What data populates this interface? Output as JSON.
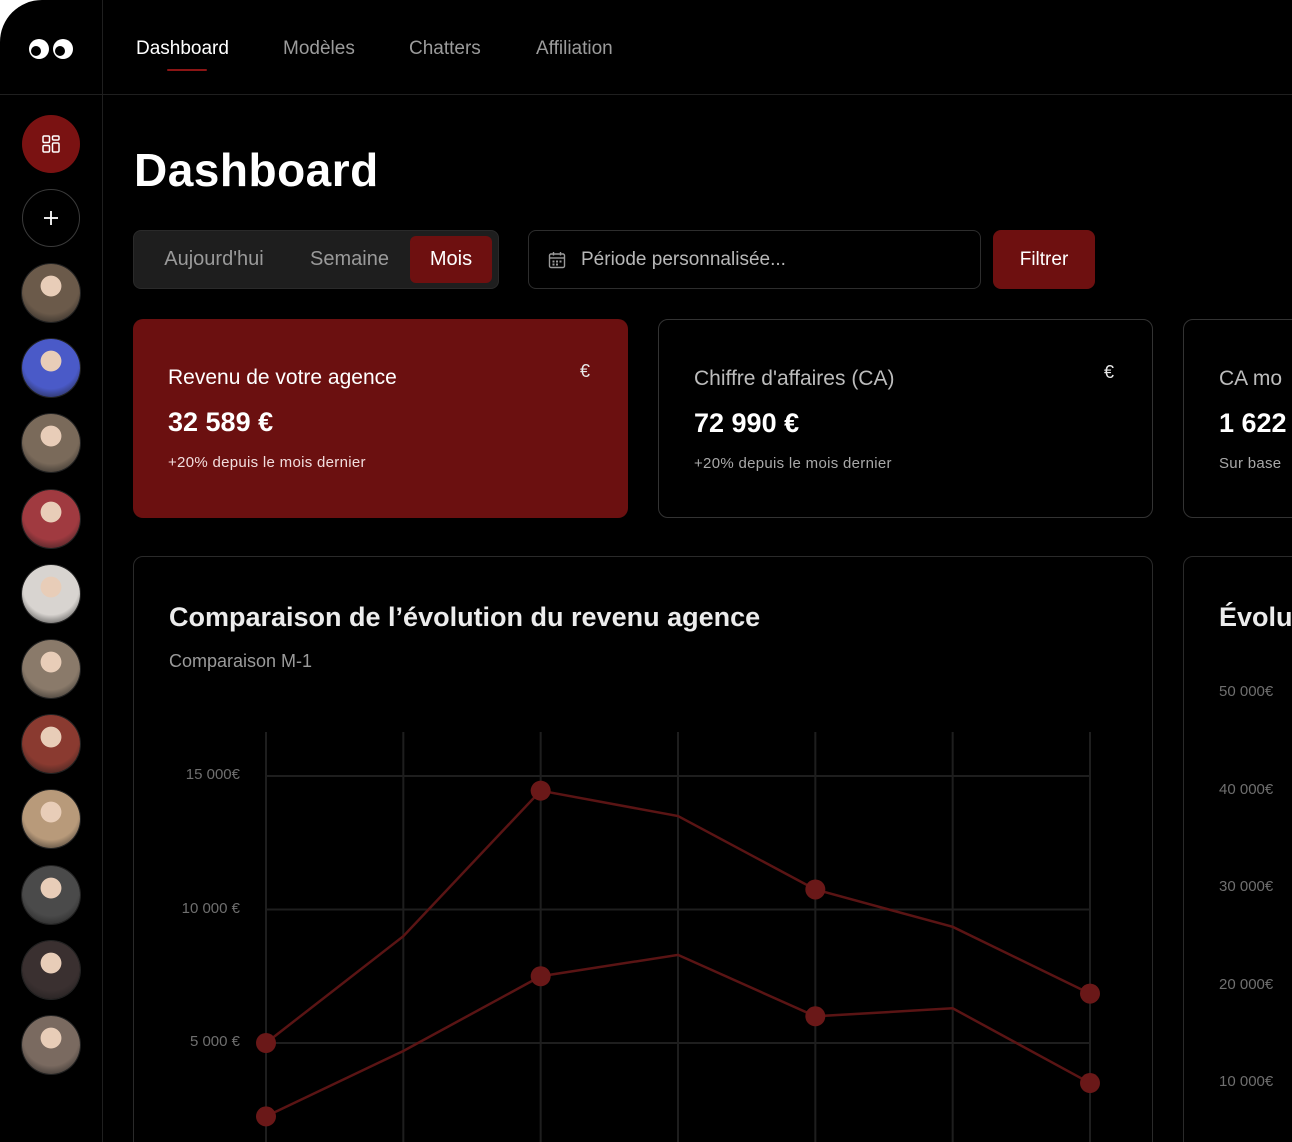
{
  "logo": {
    "icon": "eyes-logo-icon"
  },
  "sidebar": {
    "dashboard_icon": "grid-icon",
    "add_icon": "plus-icon",
    "avatars": [
      {
        "color": "#6b5a4a"
      },
      {
        "color": "#4a5ac8"
      },
      {
        "color": "#7a6a5a"
      },
      {
        "color": "#a03a40"
      },
      {
        "color": "#d8d4d0"
      },
      {
        "color": "#8a7a6a"
      },
      {
        "color": "#8a3a30"
      },
      {
        "color": "#b89a7a"
      },
      {
        "color": "#4a4a4a"
      },
      {
        "color": "#3a3030"
      },
      {
        "color": "#7a6a60"
      }
    ]
  },
  "nav": {
    "items": [
      "Dashboard",
      "Modèles",
      "Chatters",
      "Affiliation"
    ],
    "active": "Dashboard"
  },
  "page": {
    "title": "Dashboard"
  },
  "period": {
    "options": [
      "Aujourd'hui",
      "Semaine",
      "Mois"
    ],
    "selected": "Mois"
  },
  "date_input": {
    "placeholder": "Période personnalisée...",
    "icon": "calendar-icon"
  },
  "filter_button": "Filtrer",
  "cards": [
    {
      "title": "Revenu de votre agence",
      "value": "32 589 €",
      "sub": "+20% depuis le mois dernier",
      "icon": "€"
    },
    {
      "title": "Chiffre d'affaires (CA)",
      "value": "72 990 €",
      "sub": "+20% depuis le mois dernier",
      "icon": "€"
    },
    {
      "title": "CA mo",
      "value": "1 622",
      "sub": "Sur base"
    }
  ],
  "colors": {
    "accent": "#6e1010",
    "background": "#000000",
    "line": "#5a1414",
    "point": "#6a1818"
  },
  "chart_data": [
    {
      "type": "line",
      "title": "Comparaison de l’évolution du revenu agence",
      "subtitle": "Comparaison M-1",
      "x": [
        1,
        2,
        3,
        4,
        5,
        6,
        7
      ],
      "yticks": [
        "15 000€",
        "10 000 €",
        "5 000 €"
      ],
      "ytick_values": [
        15000,
        10000,
        5000
      ],
      "ylim": [
        0,
        17500
      ],
      "grid": true,
      "series": [
        {
          "values": [
            5000,
            9000,
            14450,
            13500,
            10750,
            9350,
            6850
          ],
          "markers": [
            true,
            false,
            true,
            false,
            true,
            false,
            true
          ]
        },
        {
          "values": [
            2250,
            4700,
            7500,
            8300,
            6000,
            6300,
            3500
          ],
          "markers": [
            true,
            false,
            true,
            false,
            true,
            false,
            true
          ]
        }
      ]
    },
    {
      "type": "line",
      "title": "Évolu",
      "yticks": [
        "50 000€",
        "40 000€",
        "30 000€",
        "20 000€",
        "10 000€"
      ],
      "ytick_values": [
        50000,
        40000,
        30000,
        20000,
        10000
      ]
    }
  ]
}
